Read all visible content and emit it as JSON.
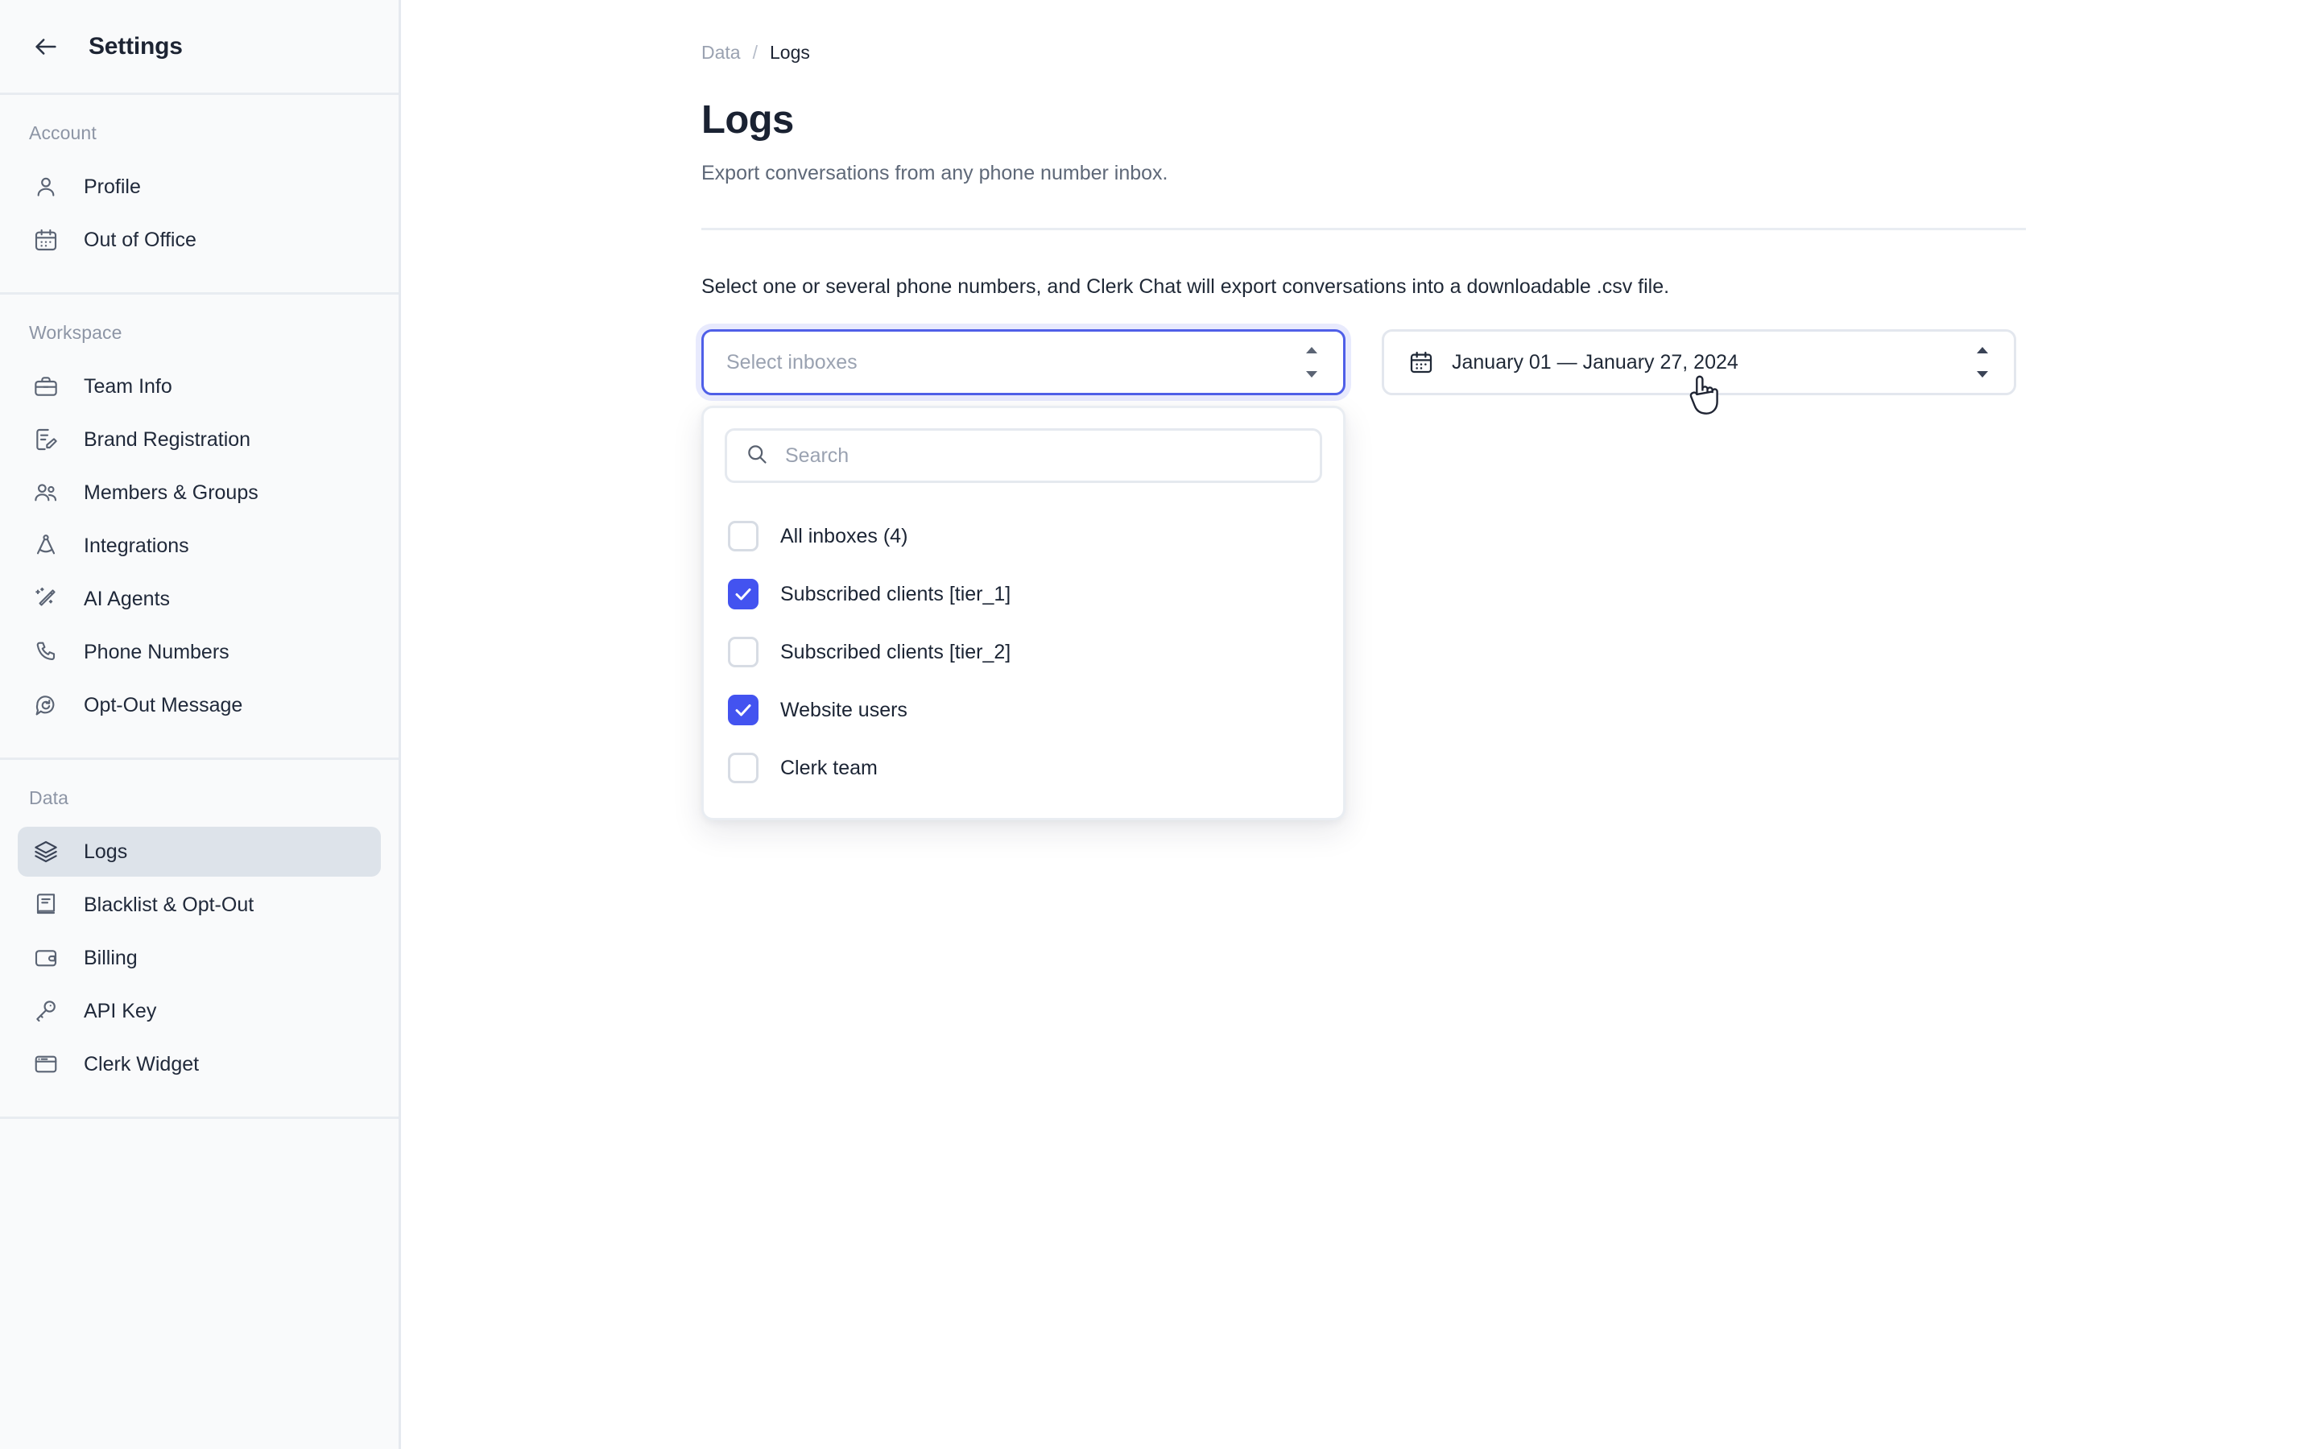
{
  "sidebar": {
    "back_icon": "arrow-left-icon",
    "title": "Settings",
    "groups": [
      {
        "label": "Account",
        "items": [
          {
            "label": "Profile",
            "icon": "user-icon",
            "active": false
          },
          {
            "label": "Out of Office",
            "icon": "calendar-icon",
            "active": false
          }
        ]
      },
      {
        "label": "Workspace",
        "items": [
          {
            "label": "Team Info",
            "icon": "briefcase-icon",
            "active": false
          },
          {
            "label": "Brand Registration",
            "icon": "document-edit-icon",
            "active": false
          },
          {
            "label": "Members & Groups",
            "icon": "users-icon",
            "active": false
          },
          {
            "label": "Integrations",
            "icon": "compass-icon",
            "active": false
          },
          {
            "label": "AI Agents",
            "icon": "magic-wand-icon",
            "active": false
          },
          {
            "label": "Phone Numbers",
            "icon": "phone-icon",
            "active": false
          },
          {
            "label": "Opt-Out Message",
            "icon": "chat-refresh-icon",
            "active": false
          }
        ]
      },
      {
        "label": "Data",
        "items": [
          {
            "label": "Logs",
            "icon": "layers-icon",
            "active": true
          },
          {
            "label": "Blacklist & Opt-Out",
            "icon": "book-icon",
            "active": false
          },
          {
            "label": "Billing",
            "icon": "wallet-icon",
            "active": false
          },
          {
            "label": "API Key",
            "icon": "key-icon",
            "active": false
          },
          {
            "label": "Clerk Widget",
            "icon": "window-icon",
            "active": false
          }
        ]
      }
    ]
  },
  "main": {
    "breadcrumb": {
      "root": "Data",
      "separator": "/",
      "current": "Logs"
    },
    "title": "Logs",
    "subtitle": "Export conversations from any phone number inbox.",
    "instruction": "Select one or several phone numbers, and Clerk Chat will export conversations into a downloadable .csv file.",
    "inbox_select": {
      "placeholder": "Select inboxes",
      "value": "",
      "stepper_icon": "stepper-updown-icon",
      "expanded": true
    },
    "date_range": {
      "calendar_icon": "calendar-icon",
      "value": "January 01 — January 27, 2024",
      "stepper_icon": "stepper-updown-icon"
    },
    "dropdown": {
      "search": {
        "icon": "search-icon",
        "placeholder": "Search",
        "value": ""
      },
      "options": [
        {
          "label": "All inboxes (4)",
          "checked": false
        },
        {
          "label": "Subscribed clients [tier_1]",
          "checked": true
        },
        {
          "label": "Subscribed clients [tier_2]",
          "checked": false
        },
        {
          "label": "Website users",
          "checked": true
        },
        {
          "label": "Clerk team",
          "checked": false
        }
      ]
    }
  },
  "cursor": {
    "icon": "pointer-hand-cursor"
  },
  "colors": {
    "accent": "#4353f0",
    "focus_ring": "#4f5fe8",
    "sidebar_bg": "#f9fafb",
    "active_item_bg": "#dde3ea",
    "text_primary": "#1d2433",
    "text_muted": "#8d95a5",
    "divider": "#e8ecf1"
  }
}
